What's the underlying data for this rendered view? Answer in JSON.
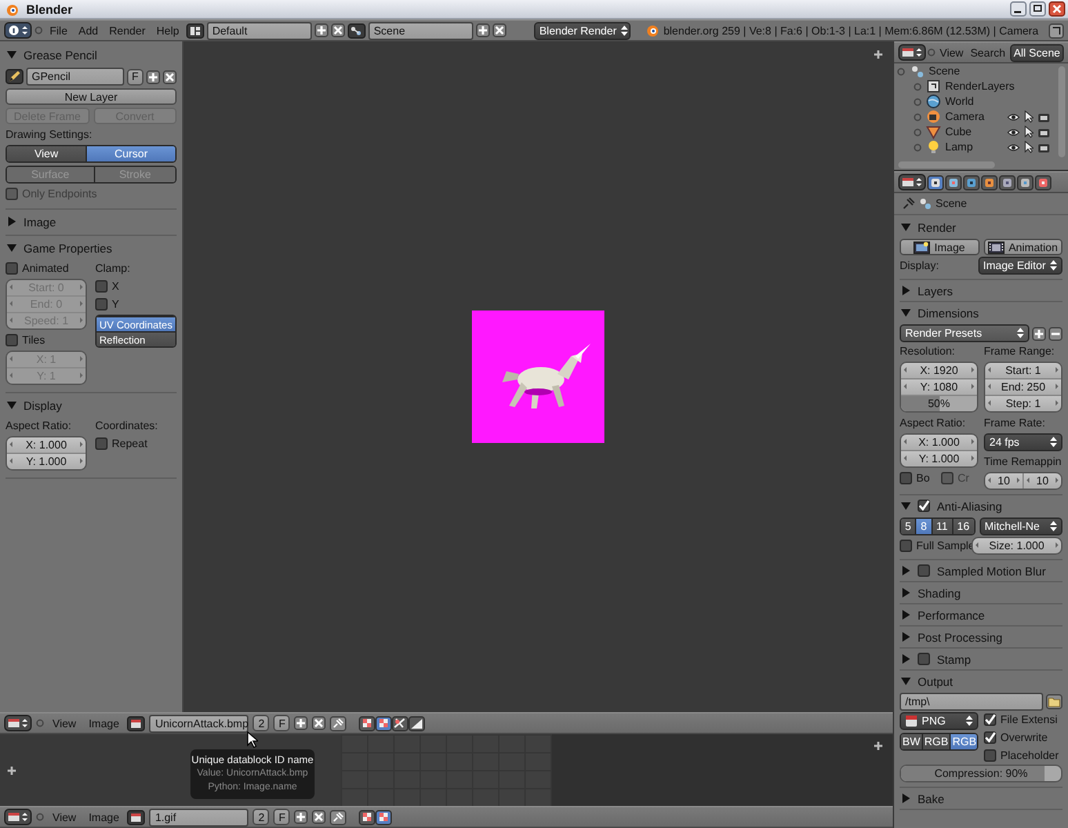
{
  "window": {
    "title": "Blender"
  },
  "top_header": {
    "menus": [
      "File",
      "Add",
      "Render",
      "Help"
    ],
    "screen": "Default",
    "scene": "Scene",
    "render_engine": "Blender Render",
    "stats": "blender.org 259 | Ve:8 | Fa:6 | Ob:1-3 | La:1 | Mem:6.86M (12.53M) | Camera"
  },
  "tool_panel": {
    "sections": [
      {
        "title": "Grease Pencil",
        "expanded": true,
        "rows": [
          {
            "kind": "gpencil_datablock",
            "name": "GPencil",
            "fake": "F"
          },
          {
            "kind": "button",
            "text": "New Layer",
            "disabled": false
          },
          {
            "kind": "row",
            "items": [
              {
                "kind": "button",
                "text": "Delete Frame",
                "disabled": true
              },
              {
                "kind": "button",
                "text": "Convert",
                "disabled": true
              }
            ]
          },
          {
            "kind": "label",
            "text": "Drawing Settings:"
          },
          {
            "kind": "segmented",
            "options": [
              {
                "text": "View",
                "selected": false,
                "disabled": false
              },
              {
                "text": "Cursor",
                "selected": true,
                "disabled": false
              }
            ]
          },
          {
            "kind": "segmented",
            "options": [
              {
                "text": "Surface",
                "selected": false,
                "disabled": true
              },
              {
                "text": "Stroke",
                "selected": false,
                "disabled": true
              }
            ]
          },
          {
            "kind": "checkbox",
            "text": "Only Endpoints",
            "checked": false,
            "disabled": true
          }
        ]
      },
      {
        "title": "Image",
        "expanded": false
      },
      {
        "title": "Game Properties",
        "expanded": true,
        "rows": [
          {
            "kind": "columns",
            "columns": [
              [
                {
                  "kind": "checkbox",
                  "text": "Animated",
                  "checked": false,
                  "disabled": false
                },
                {
                  "kind": "stack",
                  "items": [
                    {
                      "kind": "number",
                      "text": "Start: 0",
                      "disabled": true
                    },
                    {
                      "kind": "number",
                      "text": "End: 0",
                      "disabled": true
                    },
                    {
                      "kind": "number",
                      "text": "Speed: 1",
                      "disabled": true
                    }
                  ]
                },
                {
                  "kind": "checkbox",
                  "text": "Tiles",
                  "checked": false,
                  "disabled": false
                },
                {
                  "kind": "stack",
                  "items": [
                    {
                      "kind": "number",
                      "text": "X: 1",
                      "disabled": true
                    },
                    {
                      "kind": "number",
                      "text": "Y: 1",
                      "disabled": true
                    }
                  ]
                }
              ],
              [
                {
                  "kind": "label",
                  "text": "Clamp:"
                },
                {
                  "kind": "checkbox",
                  "text": "X",
                  "checked": false,
                  "disabled": false
                },
                {
                  "kind": "checkbox",
                  "text": "Y",
                  "checked": false,
                  "disabled": false
                },
                {
                  "kind": "radio_column",
                  "options": [
                    {
                      "text": "UV Coordinates",
                      "selected": true,
                      "disabled": false
                    },
                    {
                      "text": "Reflection",
                      "selected": false,
                      "disabled": false
                    }
                  ]
                }
              ]
            ]
          }
        ]
      },
      {
        "title": "Display",
        "expanded": true,
        "rows": [
          {
            "kind": "columns",
            "columns": [
              [
                {
                  "kind": "label",
                  "text": "Aspect Ratio:"
                },
                {
                  "kind": "stack",
                  "items": [
                    {
                      "kind": "number",
                      "text": "X: 1.000",
                      "disabled": false
                    },
                    {
                      "kind": "number",
                      "text": "Y: 1.000",
                      "disabled": false
                    }
                  ]
                }
              ],
              [
                {
                  "kind": "label",
                  "text": "Coordinates:"
                },
                {
                  "kind": "checkbox",
                  "text": "Repeat",
                  "checked": false,
                  "disabled": false
                }
              ]
            ]
          }
        ]
      }
    ]
  },
  "outliner": {
    "menus": [
      "View",
      "Search"
    ],
    "filter": "All Scene",
    "tree": [
      {
        "name": "Scene",
        "kind": "scene",
        "children": [
          {
            "name": "RenderLayers",
            "kind": "renderlayers"
          },
          {
            "name": "World",
            "kind": "world"
          },
          {
            "name": "Camera",
            "kind": "camera"
          },
          {
            "name": "Cube",
            "kind": "mesh"
          },
          {
            "name": "Lamp",
            "kind": "lamp"
          }
        ]
      }
    ]
  },
  "properties": {
    "tabs": [
      {
        "kind": "render",
        "selected": true
      },
      {
        "kind": "scene",
        "selected": false
      },
      {
        "kind": "world",
        "selected": false
      },
      {
        "kind": "object",
        "selected": false
      },
      {
        "kind": "constraints",
        "selected": false
      },
      {
        "kind": "modifiers",
        "selected": false
      },
      {
        "kind": "texture",
        "selected": false
      }
    ],
    "context": "Scene",
    "sections": [
      {
        "title": "Render",
        "expanded": true,
        "rows": [
          {
            "kind": "row",
            "items": [
              {
                "kind": "still_button",
                "text": "Image"
              },
              {
                "kind": "anim_button",
                "text": "Animation"
              }
            ]
          },
          {
            "kind": "row",
            "items": [
              {
                "kind": "label",
                "text": "Display:"
              },
              {
                "kind": "dropdown",
                "text": "Image Editor"
              }
            ]
          }
        ]
      },
      {
        "title": "Layers",
        "expanded": false
      },
      {
        "title": "Dimensions",
        "expanded": true,
        "rows": [
          {
            "kind": "preset",
            "text": "Render Presets"
          },
          {
            "kind": "columns",
            "columns": [
              [
                {
                  "kind": "label",
                  "text": "Resolution:"
                },
                {
                  "kind": "stack",
                  "items": [
                    {
                      "kind": "number",
                      "text": "X: 1920",
                      "disabled": false
                    },
                    {
                      "kind": "number",
                      "text": "Y: 1080",
                      "disabled": false
                    },
                    {
                      "kind": "slider",
                      "text": "50%",
                      "level": 0.5
                    }
                  ]
                },
                {
                  "kind": "label",
                  "text": "Aspect Ratio:"
                },
                {
                  "kind": "stack",
                  "items": [
                    {
                      "kind": "number",
                      "text": "X: 1.000",
                      "disabled": false
                    },
                    {
                      "kind": "number",
                      "text": "Y: 1.000",
                      "disabled": false
                    }
                  ]
                },
                {
                  "kind": "row",
                  "items": [
                    {
                      "kind": "checkbox",
                      "text": "Bo",
                      "checked": false,
                      "disabled": false
                    },
                    {
                      "kind": "checkbox",
                      "text": "Cr",
                      "checked": false,
                      "disabled": true
                    }
                  ]
                }
              ],
              [
                {
                  "kind": "label",
                  "text": "Frame Range:"
                },
                {
                  "kind": "stack",
                  "items": [
                    {
                      "kind": "number",
                      "text": "Start: 1",
                      "disabled": false
                    },
                    {
                      "kind": "number",
                      "text": "End: 250",
                      "disabled": false
                    },
                    {
                      "kind": "number",
                      "text": "Step: 1",
                      "disabled": false
                    }
                  ]
                },
                {
                  "kind": "label",
                  "text": "Frame Rate:"
                },
                {
                  "kind": "dropdown",
                  "text": "24 fps"
                },
                {
                  "kind": "label",
                  "text": "Time Remappin"
                },
                {
                  "kind": "joined_row",
                  "items": [
                    {
                      "kind": "number",
                      "text": "10",
                      "disabled": false
                    },
                    {
                      "kind": "number",
                      "text": "10",
                      "disabled": false
                    }
                  ]
                }
              ]
            ]
          }
        ]
      },
      {
        "title": "Anti-Aliasing",
        "expanded": true,
        "checked": true,
        "rows": [
          {
            "kind": "row",
            "items": [
              {
                "kind": "segmented",
                "options": [
                  {
                    "text": "5",
                    "selected": false,
                    "disabled": false
                  },
                  {
                    "text": "8",
                    "selected": true,
                    "disabled": false
                  },
                  {
                    "text": "11",
                    "selected": false,
                    "disabled": false
                  },
                  {
                    "text": "16",
                    "selected": false,
                    "disabled": false
                  }
                ]
              },
              {
                "kind": "dropdown",
                "text": "Mitchell-Ne"
              }
            ]
          },
          {
            "kind": "row",
            "items": [
              {
                "kind": "checkbox",
                "text": "Full Sample",
                "checked": false,
                "disabled": false
              },
              {
                "kind": "number",
                "text": "Size: 1.000",
                "disabled": false
              }
            ]
          }
        ]
      },
      {
        "title": "Sampled Motion Blur",
        "expanded": false,
        "checked": false
      },
      {
        "title": "Shading",
        "expanded": false
      },
      {
        "title": "Performance",
        "expanded": false
      },
      {
        "title": "Post Processing",
        "expanded": false
      },
      {
        "title": "Stamp",
        "expanded": false,
        "checked": false
      },
      {
        "title": "Output",
        "expanded": true,
        "rows": [
          {
            "kind": "path",
            "text": "/tmp\\"
          },
          {
            "kind": "columns",
            "columns": [
              [
                {
                  "kind": "format_dropdown",
                  "text": "PNG"
                },
                {
                  "kind": "segmented",
                  "options": [
                    {
                      "text": "BW",
                      "selected": false,
                      "disabled": false
                    },
                    {
                      "text": "RGB",
                      "selected": false,
                      "disabled": false
                    },
                    {
                      "text": "RGB",
                      "selected": true,
                      "disabled": false
                    }
                  ]
                }
              ],
              [
                {
                  "kind": "checkbox",
                  "text": "File Extensi",
                  "checked": true,
                  "disabled": false
                },
                {
                  "kind": "checkbox",
                  "text": "Overwrite",
                  "checked": true,
                  "disabled": false
                },
                {
                  "kind": "checkbox",
                  "text": "Placeholder",
                  "checked": false,
                  "disabled": false
                }
              ]
            ]
          },
          {
            "kind": "slider",
            "text": "Compression: 90%",
            "level": 0.9
          }
        ]
      },
      {
        "title": "Bake",
        "expanded": false
      }
    ]
  },
  "image_headers": [
    {
      "menus": [
        "View",
        "Image"
      ],
      "image": "UnicornAttack.bmp",
      "users": "2",
      "fake": "F",
      "toggles": [
        {
          "kind": "checker",
          "selected": false
        },
        {
          "kind": "checker",
          "selected": true
        },
        {
          "kind": "channels",
          "selected": false
        },
        {
          "kind": "alpha",
          "selected": false
        }
      ]
    },
    {
      "menus": [
        "View",
        "Image"
      ],
      "image": "1.gif",
      "users": "2",
      "fake": "F",
      "toggles": [
        {
          "kind": "checker",
          "selected": false
        },
        {
          "kind": "checker",
          "selected": true
        }
      ]
    }
  ],
  "tooltip": {
    "title": "Unique datablock ID name",
    "value": "Value: UnicornAttack.bmp",
    "python": "Python: Image.name"
  }
}
